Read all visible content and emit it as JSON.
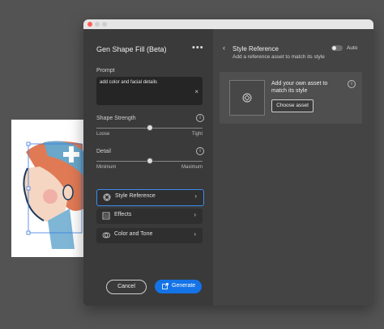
{
  "panel": {
    "title": "Gen Shape Fill (Beta)",
    "more_icon": "more-icon",
    "prompt_label": "Prompt",
    "prompt_value": "add color and facial details",
    "shape_strength_label": "Shape Strength",
    "shape_strength_min": "Loose",
    "shape_strength_max": "Tight",
    "detail_label": "Detail",
    "detail_min": "Minimum",
    "detail_max": "Maximum",
    "options": [
      {
        "label": "Style Reference",
        "icon": "style-reference-icon"
      },
      {
        "label": "Effects",
        "icon": "effects-icon"
      },
      {
        "label": "Color and Tone",
        "icon": "color-tone-icon"
      }
    ],
    "cancel_label": "Cancel",
    "generate_label": "Generate"
  },
  "style_ref": {
    "title": "Style Reference",
    "toggle_label": "Auto",
    "subtitle": "Add a reference asset to match its style",
    "card_text_line1": "Add your own asset to",
    "card_text_line2": "match its style",
    "choose_label": "Choose asset"
  },
  "colors": {
    "accent": "#1473e6",
    "window_bg": "#323232",
    "panel_bg": "#3a3a3a"
  }
}
